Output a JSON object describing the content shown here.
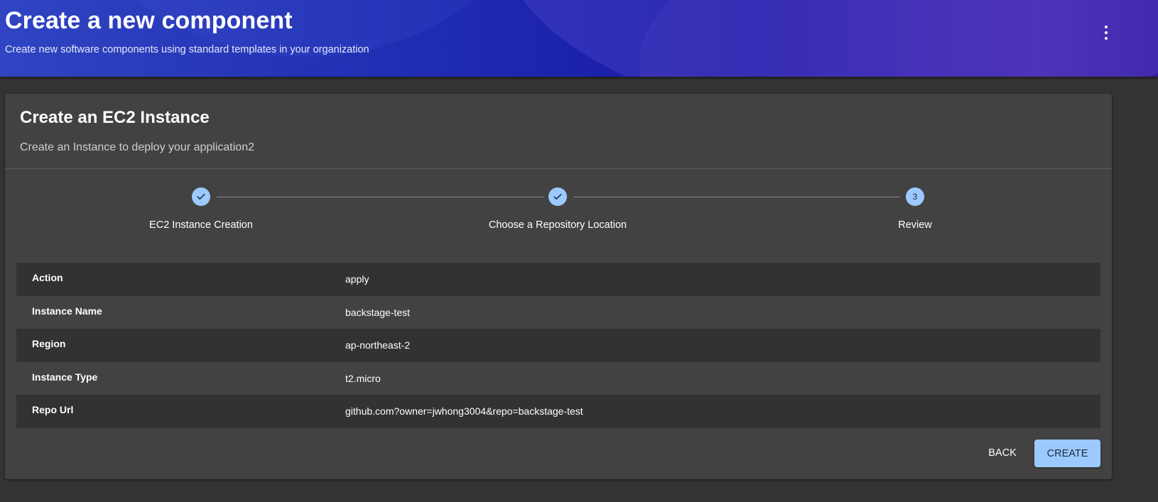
{
  "header": {
    "title": "Create a new component",
    "subtitle": "Create new software components using standard templates in your organization",
    "menu_icon": "more-vert-icon"
  },
  "card": {
    "title": "Create an EC2 Instance",
    "description": "Create an Instance to deploy your application2"
  },
  "stepper": {
    "steps": [
      {
        "label": "EC2 Instance Creation",
        "state": "completed",
        "icon": "check-icon"
      },
      {
        "label": "Choose a Repository Location",
        "state": "completed",
        "icon": "check-icon"
      },
      {
        "label": "Review",
        "state": "active",
        "number": "3"
      }
    ]
  },
  "review": {
    "rows": [
      {
        "key": "Action",
        "value": "apply"
      },
      {
        "key": "Instance Name",
        "value": "backstage-test"
      },
      {
        "key": "Region",
        "value": "ap-northeast-2"
      },
      {
        "key": "Instance Type",
        "value": "t2.micro"
      },
      {
        "key": "Repo Url",
        "value": "github.com?owner=jwhong3004&repo=backstage-test"
      }
    ]
  },
  "actions": {
    "back_label": "BACK",
    "create_label": "CREATE"
  },
  "colors": {
    "accent": "#9cc9ff",
    "card_bg": "#424242",
    "page_bg": "#333333"
  }
}
